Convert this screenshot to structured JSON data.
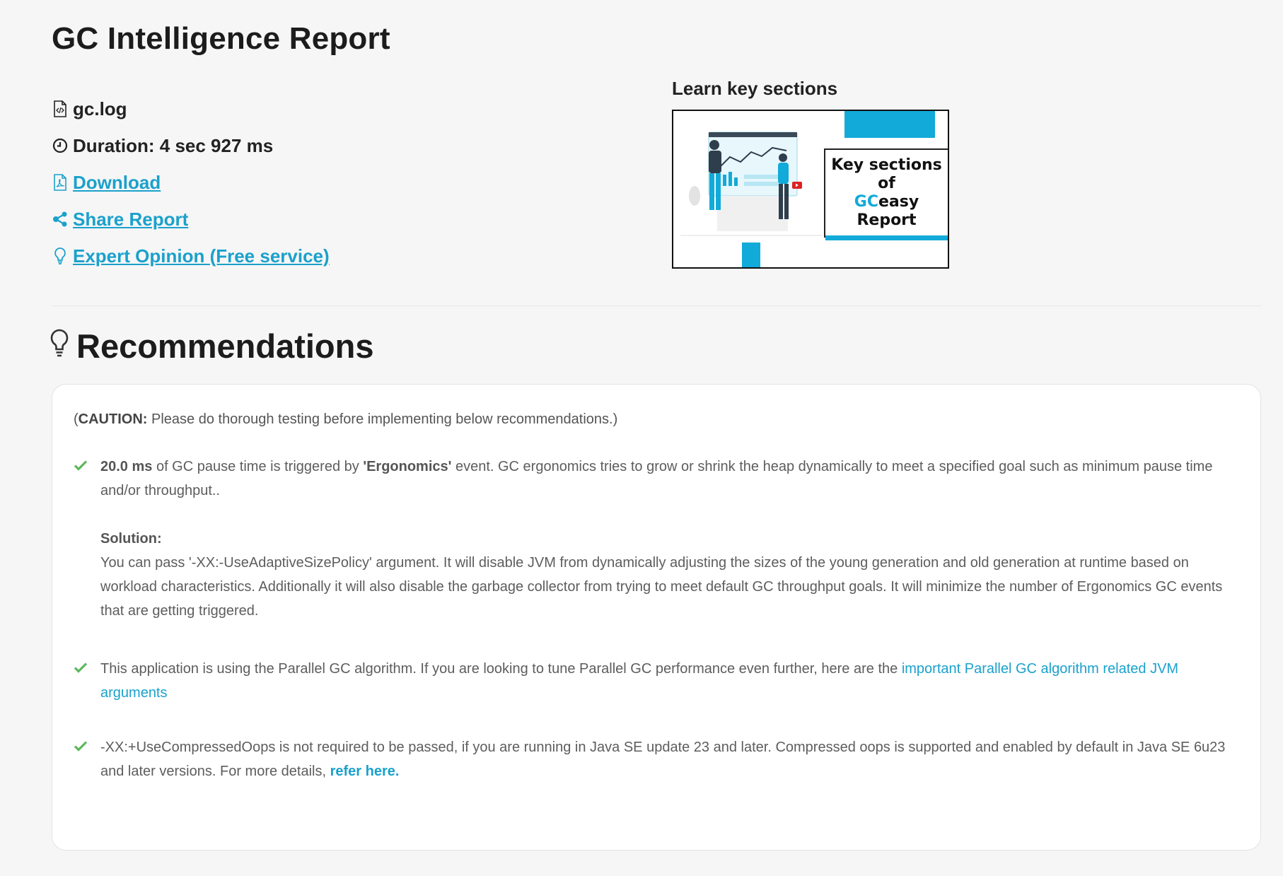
{
  "header": {
    "title": "GC Intelligence Report"
  },
  "meta": {
    "filename": "gc.log",
    "duration": "Duration: 4 sec 927 ms",
    "download": "Download",
    "share": "Share Report",
    "expert": "Expert Opinion (Free service)"
  },
  "learn": {
    "title": "Learn key sections",
    "thumb_line1": "Key sections",
    "thumb_line2": "of",
    "thumb_gc": "GC",
    "thumb_easy": "easy",
    "thumb_line4": "Report"
  },
  "recommendations": {
    "title": "Recommendations",
    "caution_label": "CAUTION:",
    "caution_text": " Please do thorough testing before implementing below recommendations.)",
    "caution_open": "(",
    "item1": {
      "pause": "20.0 ms",
      "text_a": " of GC pause time is triggered by ",
      "event": "'Ergonomics'",
      "text_b": " event. GC ergonomics tries to grow or shrink the heap dynamically to meet a specified goal such as minimum pause time and/or throughput..",
      "solution_title": "Solution:",
      "solution_text": "You can pass '-XX:-UseAdaptiveSizePolicy' argument. It will disable JVM from dynamically adjusting the sizes of the young generation and old generation at runtime based on workload characteristics. Additionally it will also disable the garbage collector from trying to meet default GC throughput goals. It will minimize the number of Ergonomics GC events that are getting triggered."
    },
    "item2": {
      "text": "This application is using the Parallel GC algorithm. If you are looking to tune Parallel GC performance even further, here are the ",
      "link": "important Parallel GC algorithm related JVM arguments"
    },
    "item3": {
      "text": "-XX:+UseCompressedOops is not required to be passed, if you are running in Java SE update 23 and later. Compressed oops is supported and enabled by default in Java SE 6u23 and later versions. For more details, ",
      "link": "refer here."
    }
  },
  "icons": {
    "file": "code-file-icon",
    "duration": "clock-icon",
    "download": "pdf-file-icon",
    "share": "share-icon",
    "expert": "lightbulb-icon",
    "recommendations": "lightbulb-icon",
    "check": "check-icon"
  },
  "colors": {
    "accent": "#1aa1cc",
    "check": "#5cb85c",
    "thumb_blue": "#12aad8"
  }
}
